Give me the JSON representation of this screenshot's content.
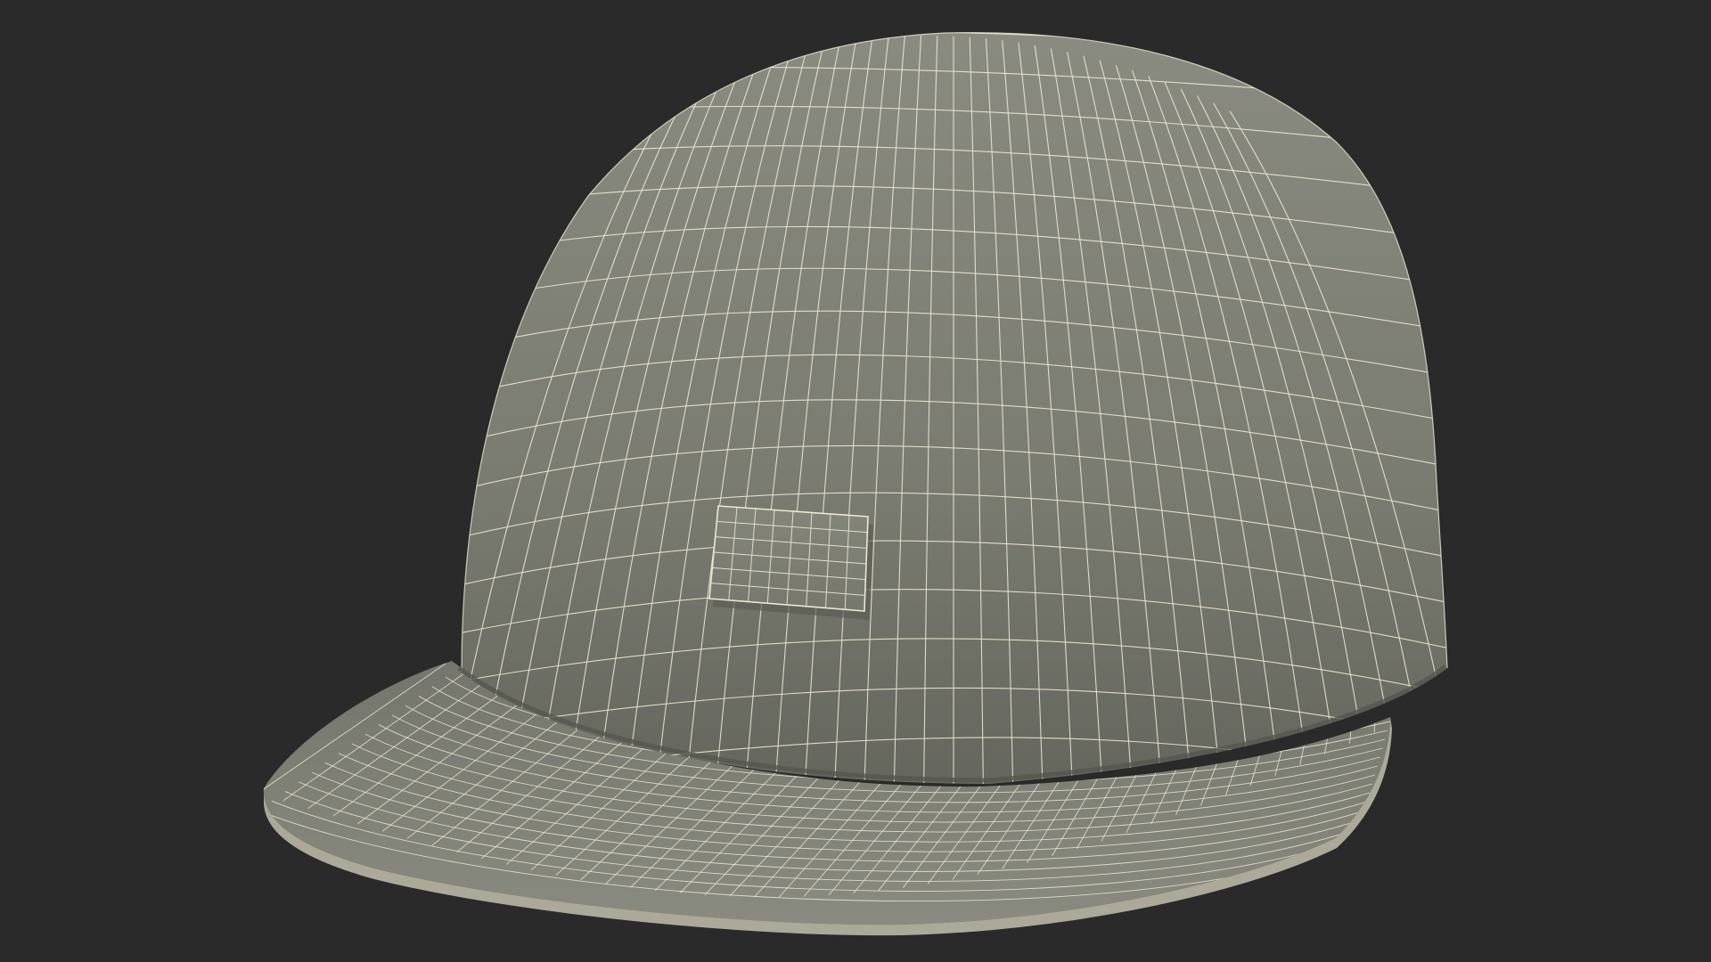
{
  "scene": {
    "subject": "cap-wireframe-render",
    "background_color": "#2a2a2a",
    "surface_color": "#7b7c72",
    "surface_shadow_color": "#5f6058",
    "wire_color": "#ece7d3"
  }
}
